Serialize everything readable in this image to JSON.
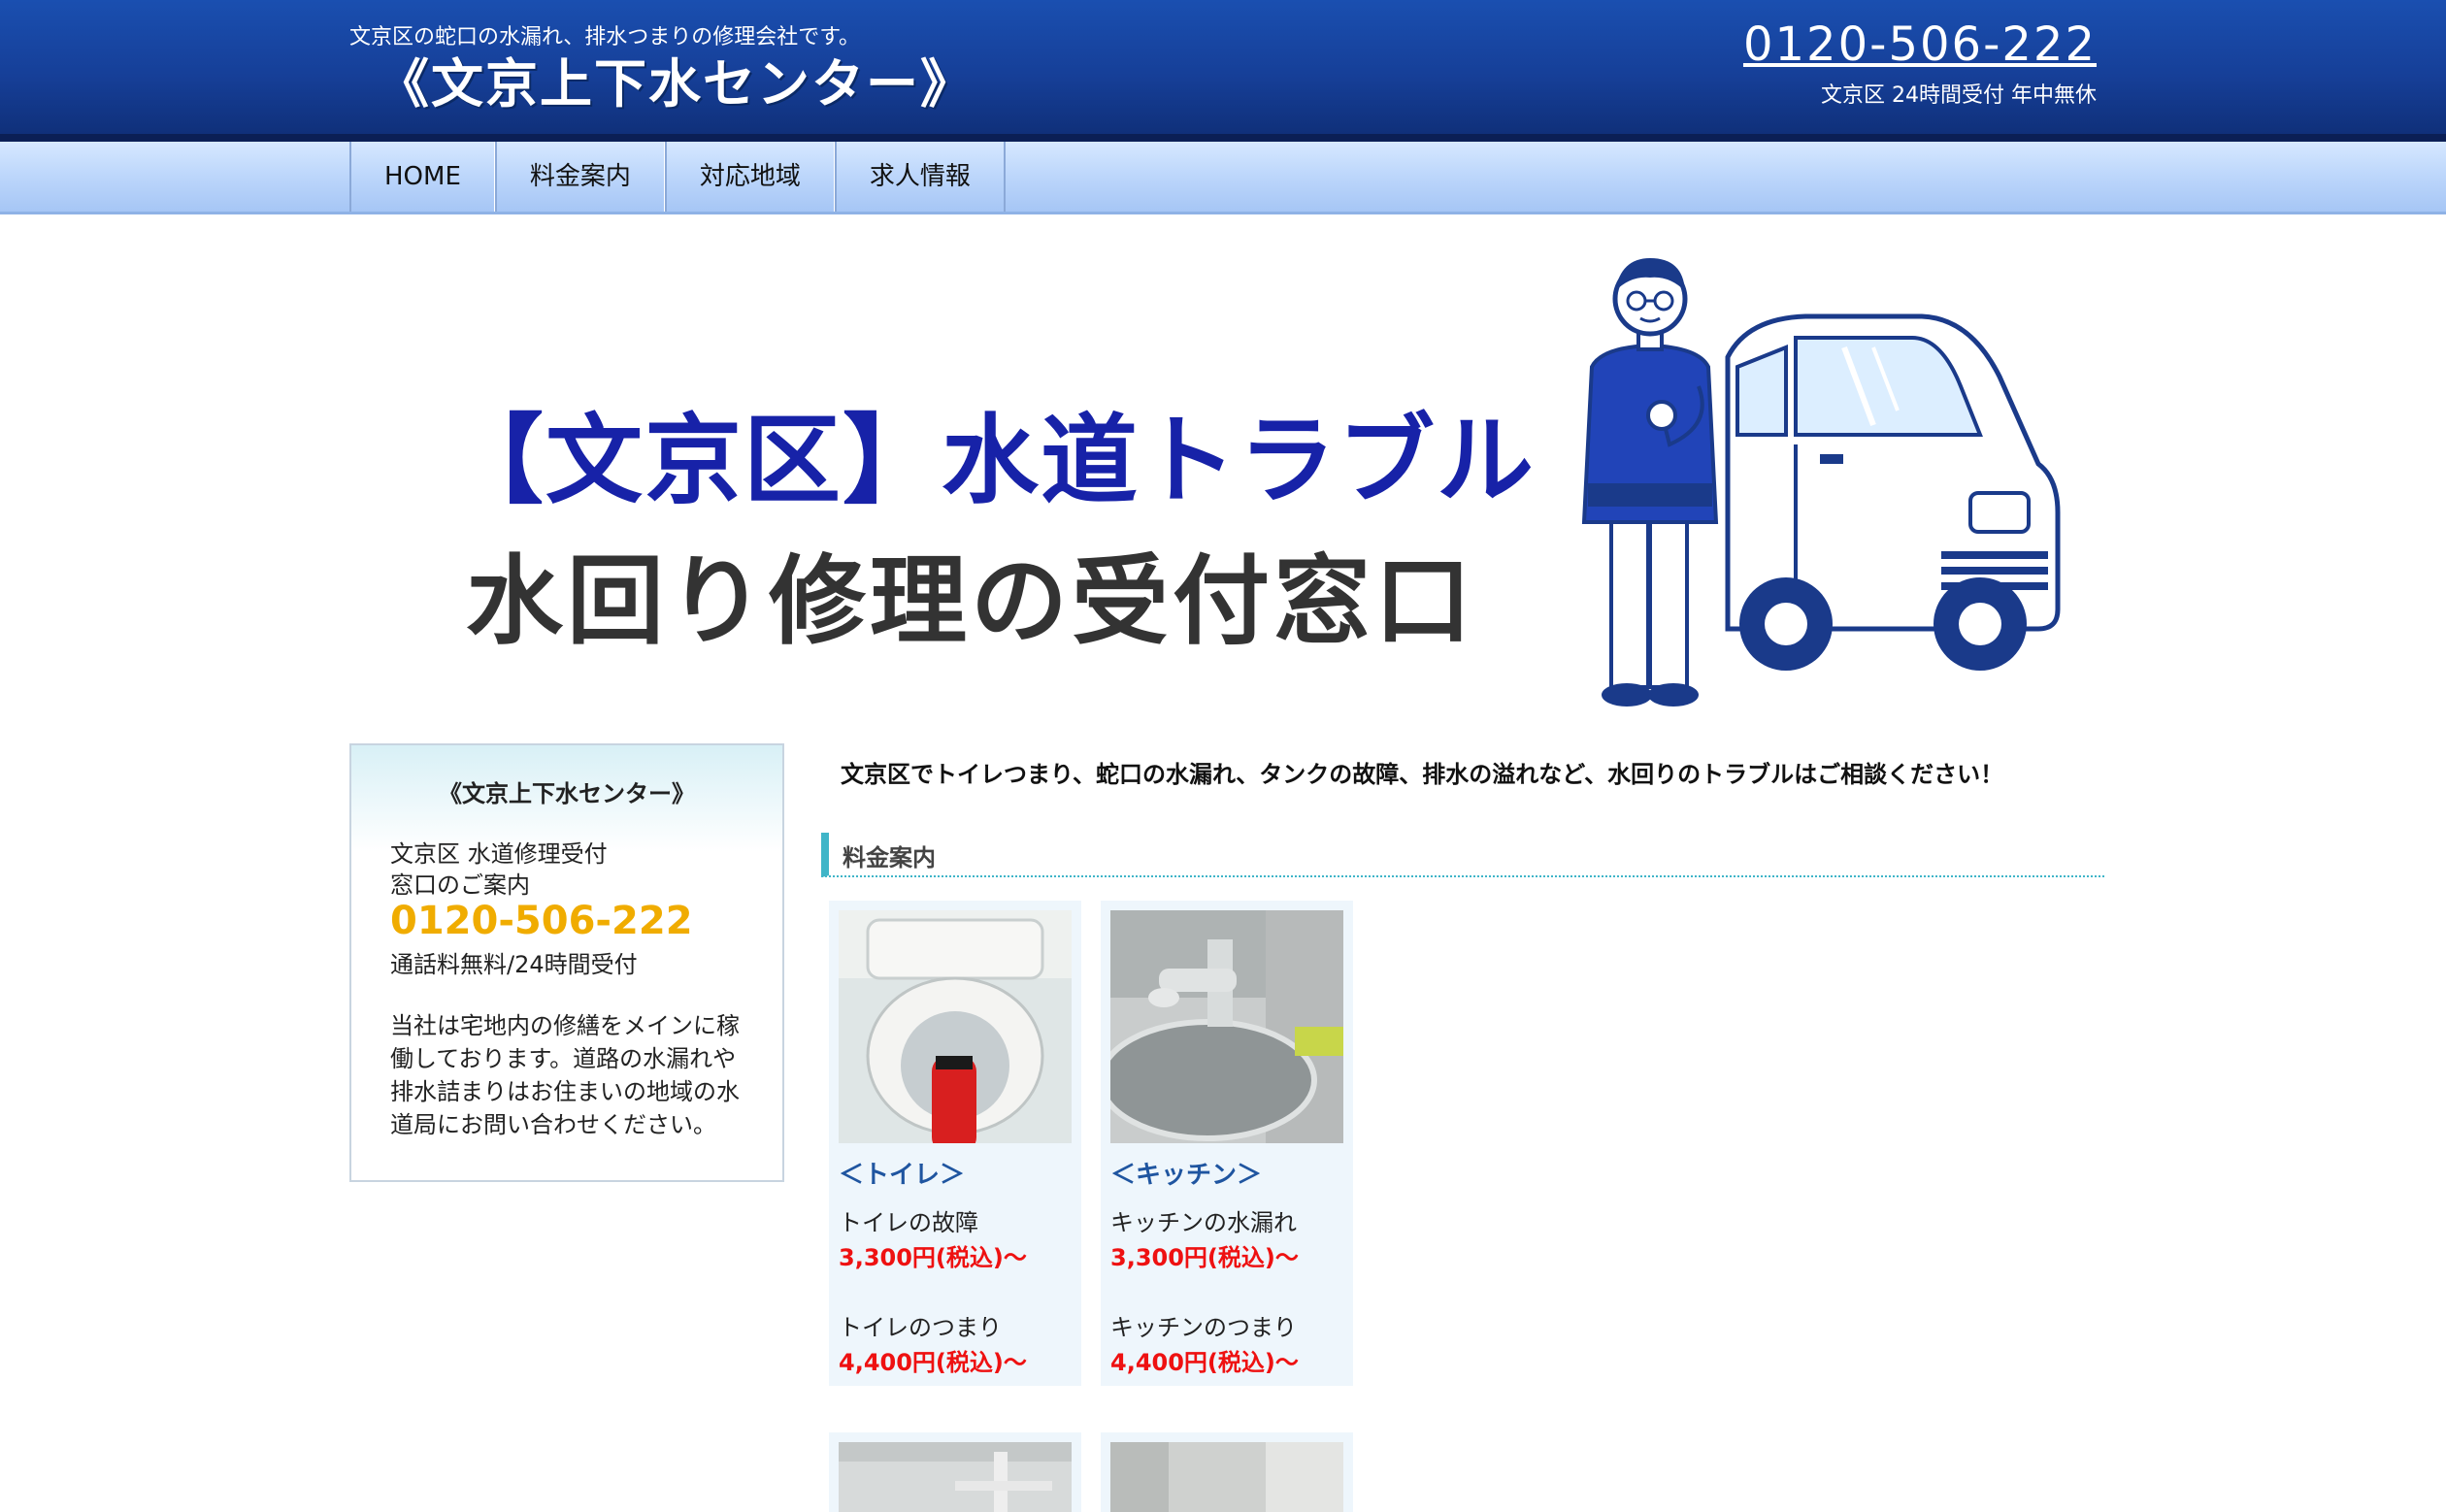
{
  "header": {
    "tagline": "文京区の蛇口の水漏れ、排水つまりの修理会社です。",
    "title": "《文京上下水センター》",
    "phone": "0120-506-222",
    "hours": "文京区 24時間受付 年中無休"
  },
  "nav": {
    "items": [
      {
        "label": "HOME"
      },
      {
        "label": "料金案内"
      },
      {
        "label": "対応地域"
      },
      {
        "label": "求人情報"
      }
    ]
  },
  "hero": {
    "line1": "【文京区】水道トラブル",
    "line2": "水回り修理の受付窓口"
  },
  "sidebar": {
    "title": "《文京上下水センター》",
    "line1": "文京区 水道修理受付",
    "line2": "窓口のご案内",
    "phone": "0120-506-222",
    "note": "通話料無料/24時間受付",
    "body": "当社は宅地内の修繕をメインに稼働しております。道路の水漏れや排水詰まりはお住まいの地域の水道局にお問い合わせください。"
  },
  "main": {
    "lead": "文京区でトイレつまり、蛇口の水漏れ、タンクの故障、排水の溢れなど、水回りのトラブルはご相談ください！",
    "section_title": "料金案内",
    "cards": [
      {
        "title": "＜トイレ＞",
        "item1": "トイレの故障",
        "price1": "3,300円(税込)〜",
        "item2": "トイレのつまり",
        "price2": "4,400円(税込)〜"
      },
      {
        "title": "＜キッチン＞",
        "item1": "キッチンの水漏れ",
        "price1": "3,300円(税込)〜",
        "item2": "キッチンのつまり",
        "price2": "4,400円(税込)〜"
      }
    ]
  },
  "colors": {
    "header_blue": "#163f98",
    "nav_light_blue": "#bcd6fb",
    "accent_teal": "#3fb5c8",
    "phone_gold": "#f0ac00",
    "price_red": "#ee1111",
    "card_title_blue": "#1f55a0",
    "hero_title_blue": "#1722a8"
  }
}
